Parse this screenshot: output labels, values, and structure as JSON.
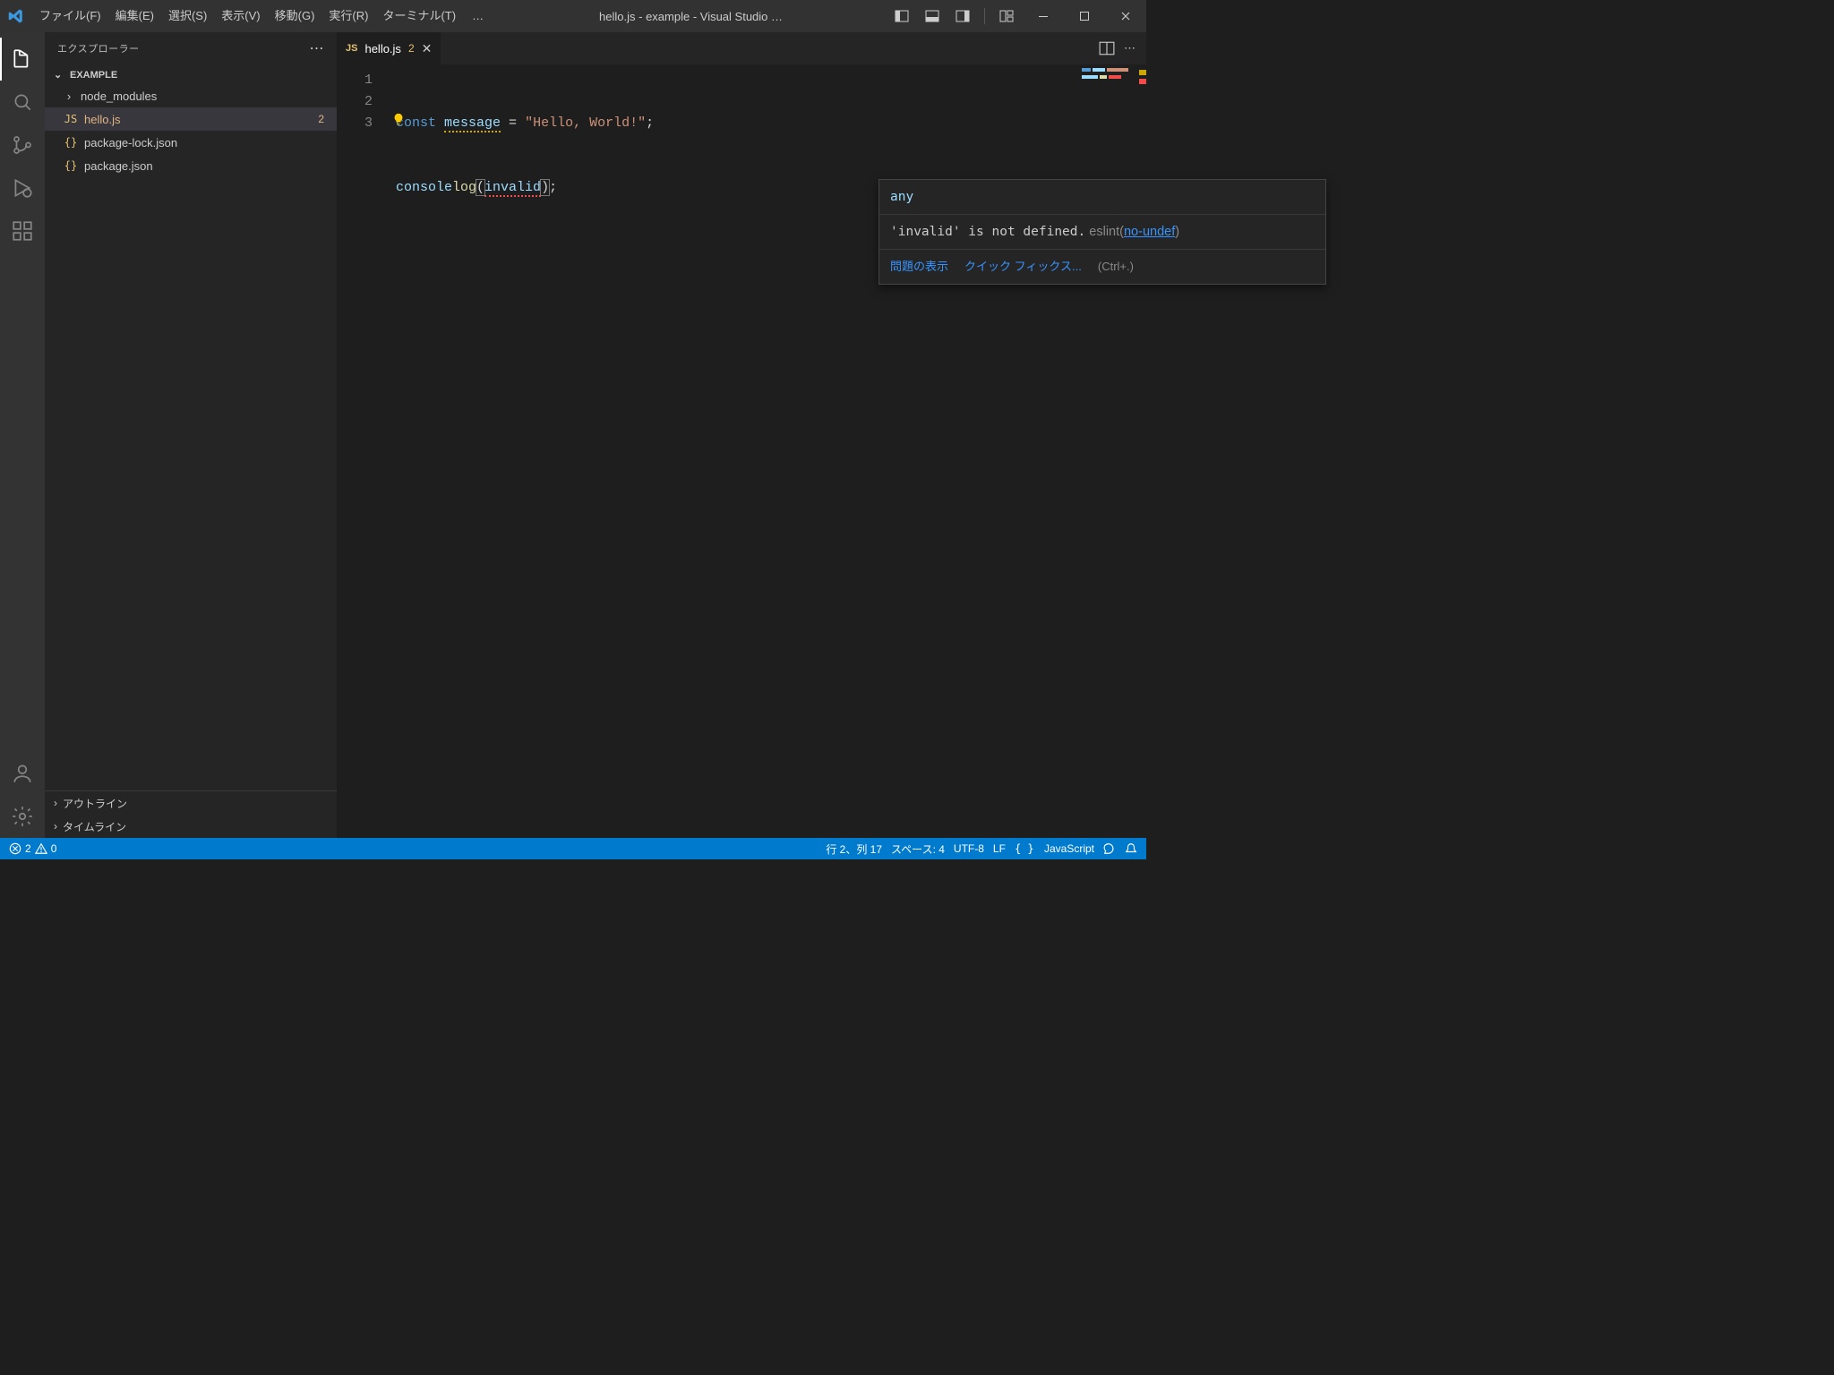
{
  "titlebar": {
    "menus": [
      "ファイル(F)",
      "編集(E)",
      "選択(S)",
      "表示(V)",
      "移動(G)",
      "実行(R)",
      "ターミナル(T)"
    ],
    "more": "…",
    "title": "hello.js - example - Visual Studio …"
  },
  "sidebar": {
    "header": "エクスプローラー",
    "root": "EXAMPLE",
    "items": [
      {
        "kind": "folder",
        "label": "node_modules"
      },
      {
        "kind": "js",
        "label": "hello.js",
        "badge": "2",
        "active": true
      },
      {
        "kind": "json",
        "label": "package-lock.json"
      },
      {
        "kind": "json",
        "label": "package.json"
      }
    ],
    "outline": "アウトライン",
    "timeline": "タイムライン"
  },
  "tab": {
    "label": "hello.js",
    "badge": "2"
  },
  "code": {
    "lines": [
      "1",
      "2",
      "3"
    ],
    "l1": {
      "const": "const",
      "msg": "message",
      "eq": " = ",
      "str": "\"Hello, World!\"",
      "semi": ";"
    },
    "l2": {
      "console": "console",
      ".": ".",
      "log": "log",
      "open": "(",
      "arg": "invalid",
      "close": ")",
      "semi": ";"
    }
  },
  "hover": {
    "type": "any",
    "msg_pre": "'invalid' is not defined.",
    "source": "eslint",
    "rule": "no-undef",
    "view_problem": "問題の表示",
    "quick_fix": "クイック フィックス...",
    "hint": "(Ctrl+.)"
  },
  "status": {
    "errors": "2",
    "warnings": "0",
    "lncol": "行 2、列 17",
    "spaces": "スペース: 4",
    "encoding": "UTF-8",
    "eol": "LF",
    "lang": "JavaScript"
  }
}
